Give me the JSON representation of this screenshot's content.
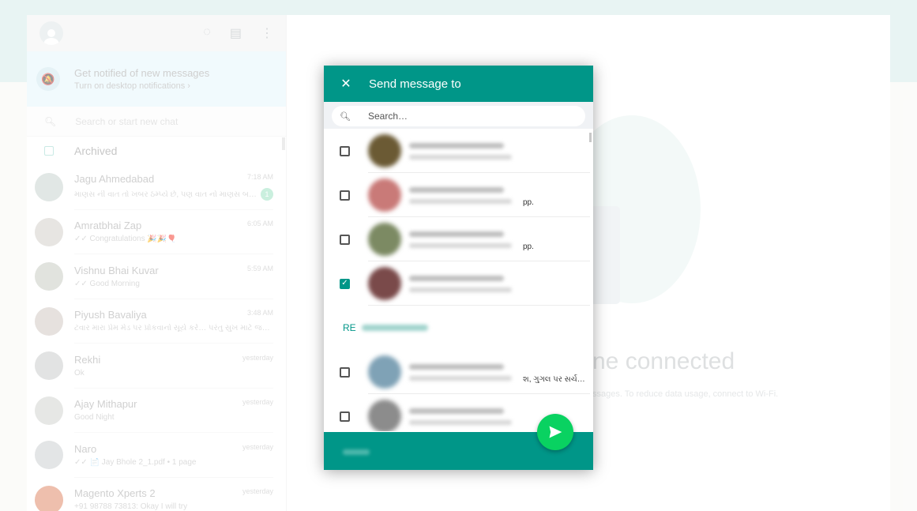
{
  "sidebar": {
    "notification": {
      "title": "Get notified of new messages",
      "subtitle": "Turn on desktop notifications ›"
    },
    "search_placeholder": "Search or start new chat",
    "archived_label": "Archived",
    "chats": [
      {
        "name": "Jagu Ahmedabad",
        "time": "7:18 AM",
        "preview": "માણસ ની વાત તો ખબર ઠમ્પ્યે છે, પણ વાત નો માણસ બહુ ઓછા…",
        "unread": "1"
      },
      {
        "name": "Amratbhai Zap",
        "time": "6:05 AM",
        "preview": "✓✓ Congratulations 🎉🎉🎈"
      },
      {
        "name": "Vishnu Bhai Kuvar",
        "time": "5:59 AM",
        "preview": "✓✓ Good Morning"
      },
      {
        "name": "Piyush Bavaliya",
        "time": "3:48 AM",
        "preview": "ટવાર મારા પ્રેમ મેડ પર પ્રોકવાનો સૂર્ય કરે… પરંતુ સુખ માટે જરા…"
      },
      {
        "name": "Rekhi",
        "time": "yesterday",
        "preview": "Ok"
      },
      {
        "name": "Ajay Mithapur",
        "time": "yesterday",
        "preview": "Good Night"
      },
      {
        "name": "Naro",
        "time": "yesterday",
        "preview": "✓✓ 📄 Jay Bhole 2_1.pdf • 1 page"
      },
      {
        "name": "Magento Xperts 2",
        "time": "yesterday",
        "preview": "+91 98788 73813: Okay I will try"
      }
    ]
  },
  "main": {
    "title": "ne connected",
    "subtitle": "ssages. To reduce data usage, connect to Wi-Fi."
  },
  "dialog": {
    "title": "Send message to",
    "close_label": "✕",
    "search_placeholder": "Search…",
    "section_label": "RE",
    "rows": [
      {
        "checked": false,
        "tail": ""
      },
      {
        "checked": false,
        "tail": "pp."
      },
      {
        "checked": false,
        "tail": "pp."
      },
      {
        "checked": true,
        "tail": ""
      },
      {
        "checked": false,
        "tail": "શ, ગુગલ પર સર્ચ…"
      },
      {
        "checked": false,
        "tail": ""
      }
    ]
  },
  "colors": {
    "accent": "#009688",
    "send": "#09d261",
    "band": "#d6ecea"
  }
}
